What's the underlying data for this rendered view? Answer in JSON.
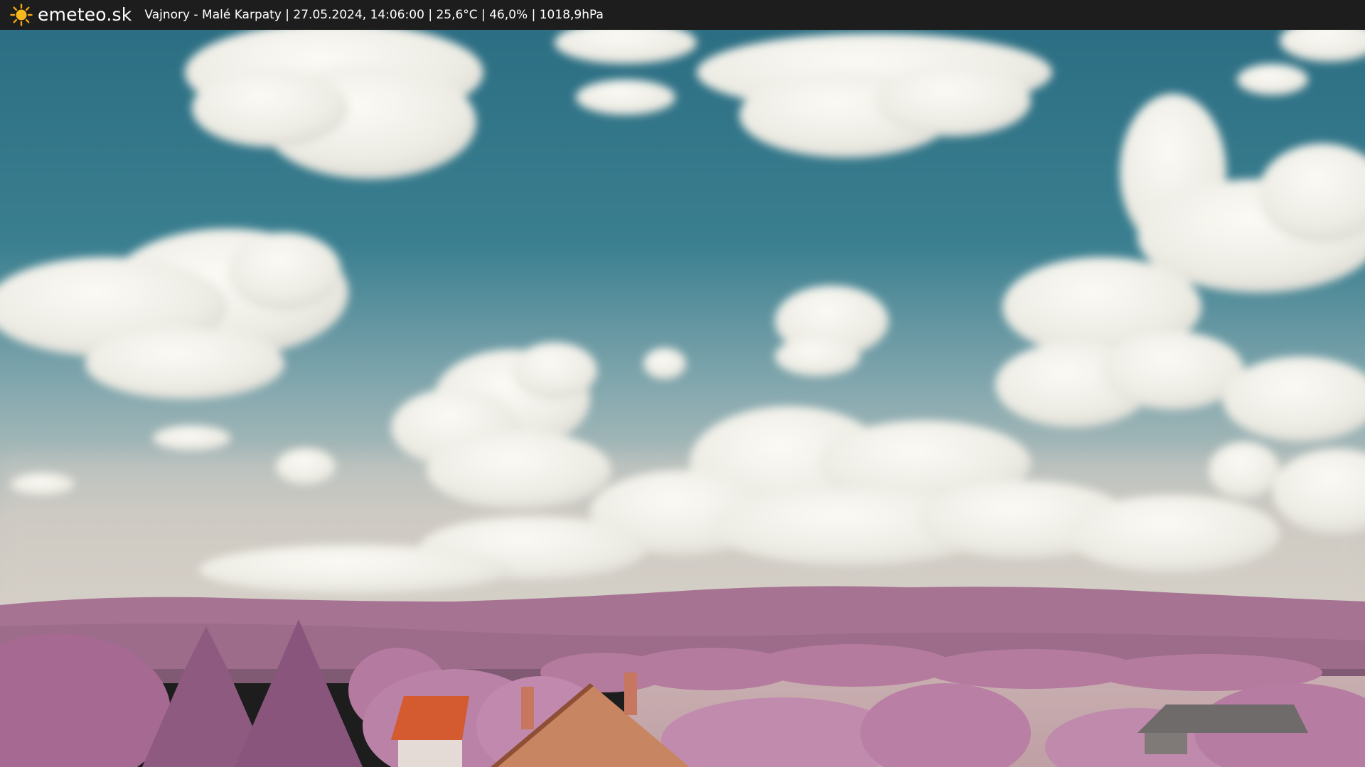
{
  "header": {
    "brand": "emeteo.sk",
    "info": "Vajnory - Malé Karpaty | 27.05.2024, 14:06:00 | 25,6°C | 46,0% | 1018,9hPa",
    "logo_icon": "sun-icon"
  },
  "colors": {
    "bar_background": "#1d1d1d",
    "sky_top": "#2f7286",
    "sky_horizon": "#d2cdc6",
    "hills": "#a97494",
    "foliage": "#b97ca4",
    "roof": "#d45a2f"
  }
}
